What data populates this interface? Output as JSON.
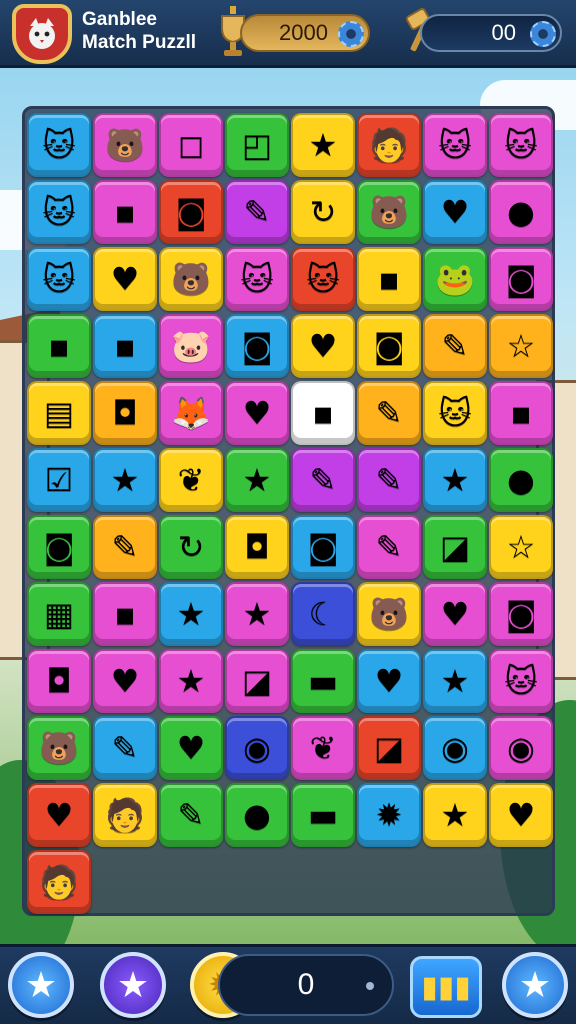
{
  "header": {
    "title_line1": "Ganblee",
    "title_line2": "Match Puzzll",
    "coins_value": "2000",
    "hammers_value": "00"
  },
  "board": {
    "rows": [
      [
        [
          "#2aa7e8",
          "🐱"
        ],
        [
          "#e64fd2",
          "🐻"
        ],
        [
          "#e64fd2",
          "◻"
        ],
        [
          "#37c23c",
          "◰"
        ],
        [
          "#ffd21c",
          "★"
        ],
        [
          "#e8452b",
          "🧑"
        ],
        [
          "#e64fd2",
          "🐱"
        ],
        [
          "#e64fd2",
          "🐱"
        ]
      ],
      [
        [
          "#2aa7e8",
          "🐱"
        ],
        [
          "#e64fd2",
          "▪"
        ],
        [
          "#e8452b",
          "◙"
        ],
        [
          "#c23ee6",
          "✎"
        ],
        [
          "#ffd21c",
          "↻"
        ],
        [
          "#37c23c",
          "🐻"
        ],
        [
          "#2aa7e8",
          "♥"
        ],
        [
          "#e64fd2",
          "●"
        ]
      ],
      [
        [
          "#2aa7e8",
          "🐱"
        ],
        [
          "#ffd21c",
          "♥"
        ],
        [
          "#ffd21c",
          "🐻"
        ],
        [
          "#e64fd2",
          "🐱"
        ],
        [
          "#e8452b",
          "🐱"
        ],
        [
          "#ffd21c",
          "▪"
        ],
        [
          "#37c23c",
          "🐸"
        ],
        [
          "#e64fd2",
          "◙"
        ]
      ],
      [
        [
          "#37c23c",
          "▪"
        ],
        [
          "#2aa7e8",
          "▪"
        ],
        [
          "#e64fd2",
          "🐷"
        ],
        [
          "#2aa7e8",
          "◙"
        ],
        [
          "#ffd21c",
          "♥"
        ],
        [
          "#ffd21c",
          "◙"
        ],
        [
          "#ffb21c",
          "✎"
        ],
        [
          "#ffb21c",
          "☆"
        ]
      ],
      [
        [
          "#ffd21c",
          "▤"
        ],
        [
          "#ffb21c",
          "◘"
        ],
        [
          "#e64fd2",
          "🦊"
        ],
        [
          "#e64fd2",
          "♥"
        ],
        [
          "#ffffff",
          "▪"
        ],
        [
          "#ffb21c",
          "✎"
        ],
        [
          "#ffd21c",
          "🐱"
        ],
        [
          "#e64fd2",
          "▪"
        ]
      ],
      [
        [
          "#2aa7e8",
          "☑"
        ],
        [
          "#2aa7e8",
          "★"
        ],
        [
          "#ffd21c",
          "❦"
        ],
        [
          "#37c23c",
          "★"
        ],
        [
          "#c23ee6",
          "✎"
        ],
        [
          "#c23ee6",
          "✎"
        ],
        [
          "#2aa7e8",
          "★"
        ]
      ],
      [
        [
          "#37c23c",
          "●"
        ],
        [
          "#37c23c",
          "◙"
        ],
        [
          "#ffb21c",
          "✎"
        ],
        [
          "#37c23c",
          "↻"
        ],
        [
          "#ffd21c",
          "◘"
        ],
        [
          "#2aa7e8",
          "◙"
        ],
        [
          "#e64fd2",
          "✎"
        ]
      ],
      [
        [
          "#37c23c",
          "◪"
        ],
        [
          "#ffd21c",
          "☆"
        ],
        [
          "#37c23c",
          "▦"
        ],
        [
          "#e64fd2",
          "▪"
        ],
        [
          "#2aa7e8",
          "★"
        ],
        [
          "#e64fd2",
          "★"
        ],
        [
          "#3b4fd8",
          "☾"
        ]
      ],
      [
        [
          "#ffd21c",
          "🐻"
        ],
        [
          "#e64fd2",
          "♥"
        ],
        [
          "#e64fd2",
          "◙"
        ],
        [
          "#e64fd2",
          "◘"
        ],
        [
          "#e64fd2",
          "♥"
        ],
        [
          "#e64fd2",
          "★"
        ],
        [
          "#e64fd2",
          "◪"
        ]
      ],
      [
        [
          "#37c23c",
          "▬"
        ],
        [
          "#2aa7e8",
          "♥"
        ],
        [
          "#2aa7e8",
          "★"
        ],
        [
          "#e64fd2",
          "🐱"
        ],
        [
          "#37c23c",
          "🐻"
        ],
        [
          "#2aa7e8",
          "✎"
        ],
        [
          "#37c23c",
          "♥"
        ]
      ],
      [
        [
          "#3b4fd8",
          "◉"
        ],
        [
          "#e64fd2",
          "❦"
        ],
        [
          "#e8452b",
          "◪"
        ],
        [
          "#2aa7e8",
          "◉"
        ],
        [
          "#e64fd2",
          "◉"
        ],
        [
          "#e8452b",
          "♥"
        ],
        [
          "#ffd21c",
          "🧑"
        ]
      ],
      [
        [
          "#37c23c",
          "✎"
        ],
        [
          "#37c23c",
          "●"
        ],
        [
          "#37c23c",
          "▬"
        ],
        [
          "#2aa7e8",
          "✹"
        ],
        [
          "#ffd21c",
          "★"
        ],
        [
          "#ffd21c",
          "♥"
        ],
        [
          "#e8452b",
          "🧑"
        ]
      ]
    ]
  },
  "footer": {
    "score_value": "0"
  },
  "colors": {
    "header_bg": "#1d3a62",
    "board_bg": "#283650",
    "accent_blue": "#2aa7e8",
    "accent_pink": "#e64fd2",
    "accent_yellow": "#ffd21c",
    "accent_green": "#37c23c"
  },
  "icons": {
    "logo": "shield-cat-icon",
    "coins": "trophy-icon",
    "hammers": "hammer-icon",
    "settings": "gear-icon",
    "powerup_1": "star-icon",
    "powerup_2": "star-icon",
    "powerup_3": "sun-coin-icon",
    "powerup_4": "tiles-icon",
    "powerup_5": "star-icon"
  }
}
